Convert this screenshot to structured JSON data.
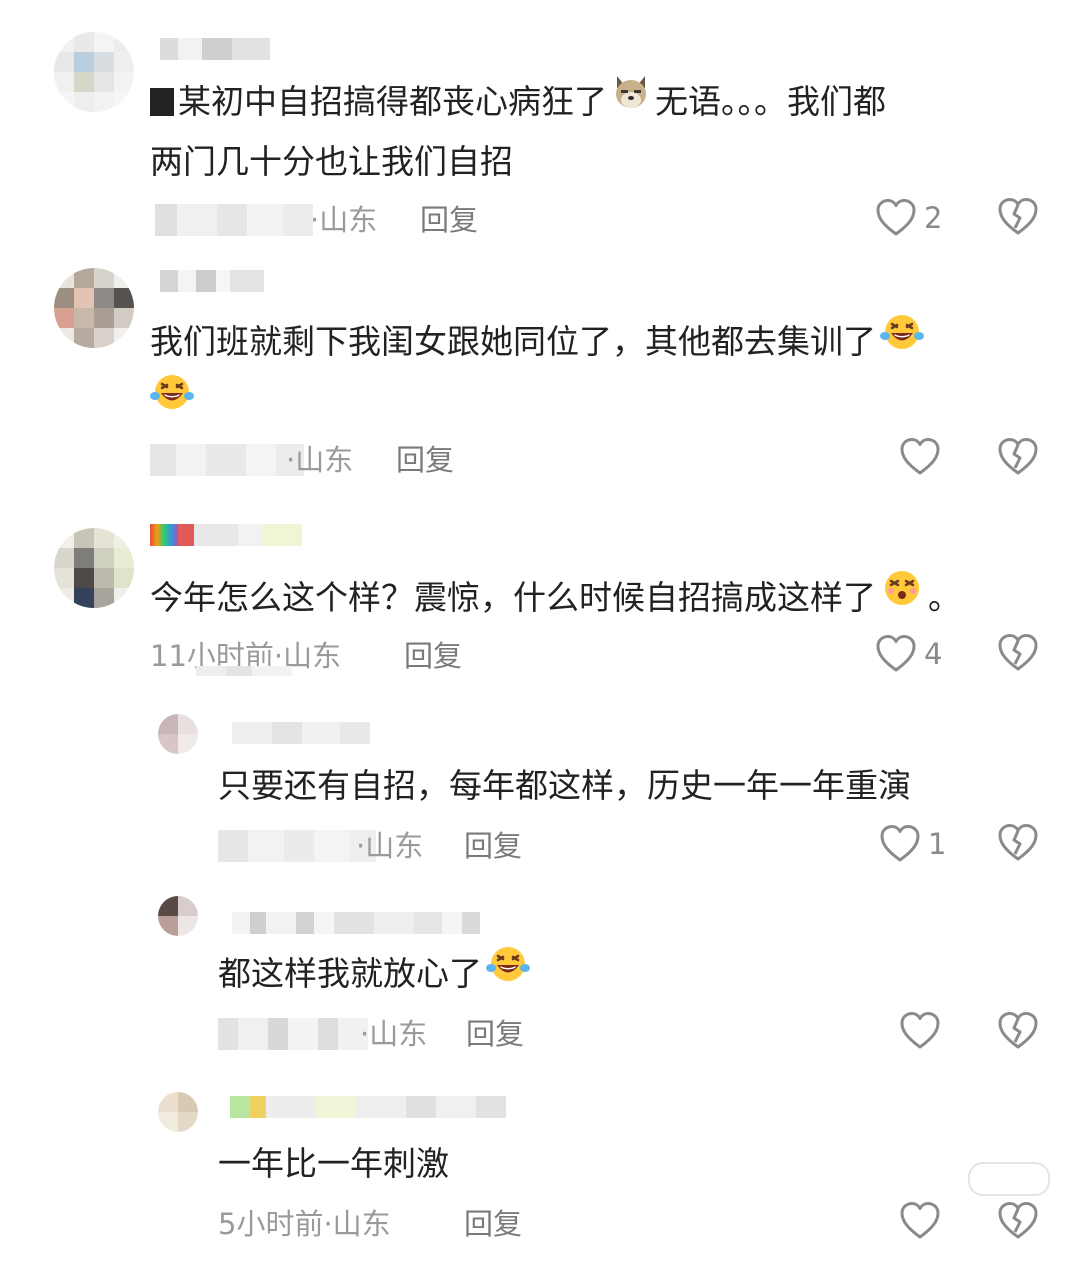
{
  "comments": [
    {
      "text_line1": "某初中自招搞得都丧心病狂了",
      "text_line1_suffix": "无语。。。我们都",
      "text_line2": "两门几十分也让我们自招",
      "time_suffix": "·山东",
      "reply": "回复",
      "likes": "2",
      "inline_icon": "doge-emoji"
    },
    {
      "text_line1": "我们班就剩下我闺女跟她同位了，其他都去集训了",
      "time_suffix": "·山东",
      "reply": "回复",
      "likes": "",
      "inline_icon": "laughing-tears-emoji"
    },
    {
      "text_line1": "今年怎么这个样？震惊，什么时候自招搞成这样了",
      "text_line1_end": "。",
      "time": "11小时前·山东",
      "reply": "回复",
      "likes": "4",
      "inline_icon": "dizzy-face-emoji"
    },
    {
      "text_line1": "只要还有自招，每年都这样，历史一年一年重演",
      "time_suffix": "·山东",
      "reply": "回复",
      "likes": "1"
    },
    {
      "text_line1": "都这样我就放心了",
      "time_suffix": "·山东",
      "reply": "回复",
      "likes": "",
      "inline_icon": "laughing-tears-emoji"
    },
    {
      "text_line1": "一年比一年刺激",
      "time": "5小时前·山东",
      "reply": "回复",
      "likes": ""
    }
  ],
  "icons": {
    "like": "heart-outline-icon",
    "dislike": "broken-heart-icon"
  },
  "colors": {
    "text": "#222222",
    "meta": "#9a9a9a",
    "icon": "#8a8a8a"
  }
}
